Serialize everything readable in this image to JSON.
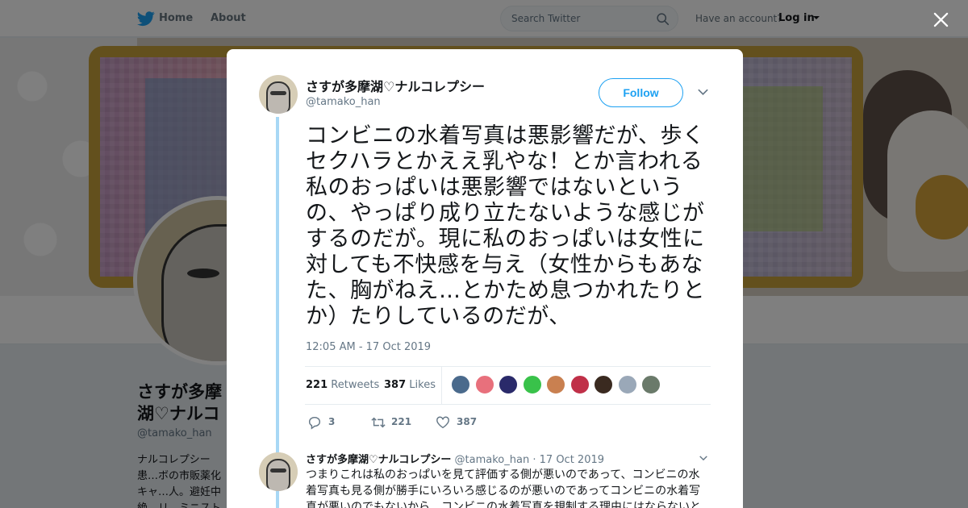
{
  "colors": {
    "brand": "#1da1f2",
    "thread_line": "#a8d8f5",
    "muted": "#657786",
    "text": "#14171a"
  },
  "nav": {
    "home_label": "Home",
    "about_label": "About",
    "search_placeholder": "Search Twitter",
    "have_account": "Have an account?",
    "login_label": "Log in",
    "logo_icon": "twitter-bird-icon"
  },
  "profile": {
    "name": "さすが多摩湖♡ナルコレプシー",
    "handle": "@tamako_han",
    "bio": "ナルコレプシー患…ボの市販薬化キャ…人。避妊中絶、リ…ミニストを名乗る…"
  },
  "tweet": {
    "author_name": "さすが多摩湖♡ナルコレプシー",
    "author_handle": "@tamako_han",
    "follow_label": "Follow",
    "text": "コンビニの水着写真は悪影響だが、歩くセクハラとかええ乳やな！とか言われる私のおっぱいは悪影響ではないというの、やっぱり成り立たないような感じがするのだが。現に私のおっぱいは女性に対しても不快感を与え（女性からもあなた、胸がねえ…とかため息つかれたりとか）たりしているのだが、",
    "timestamp": "12:05 AM - 17 Oct 2019",
    "retweets_count": "221",
    "retweets_label": "Retweets",
    "likes_count": "387",
    "likes_label": "Likes",
    "likers": [
      "#4a6a8c",
      "#e8707c",
      "#2a2a6a",
      "#39c24a",
      "#c98050",
      "#c03048",
      "#3a2a20",
      "#9aa8b8",
      "#6a7a6a"
    ],
    "reply_count": "3",
    "retweet_action_count": "221",
    "like_action_count": "387"
  },
  "reply": {
    "author_name": "さすが多摩湖♡ナルコレプシー",
    "author_handle": "@tamako_han",
    "separator": "·",
    "date": "17 Oct 2019",
    "text": "つまりこれは私のおっぱいを見て評価する側が悪いのであって、コンビニの水着写真も見る側が勝手にいろいろ感じるのが悪いのであってコンビニの水着写真が悪いのでもないから、コンビニの水着写真を規制する理由にはならないと"
  }
}
